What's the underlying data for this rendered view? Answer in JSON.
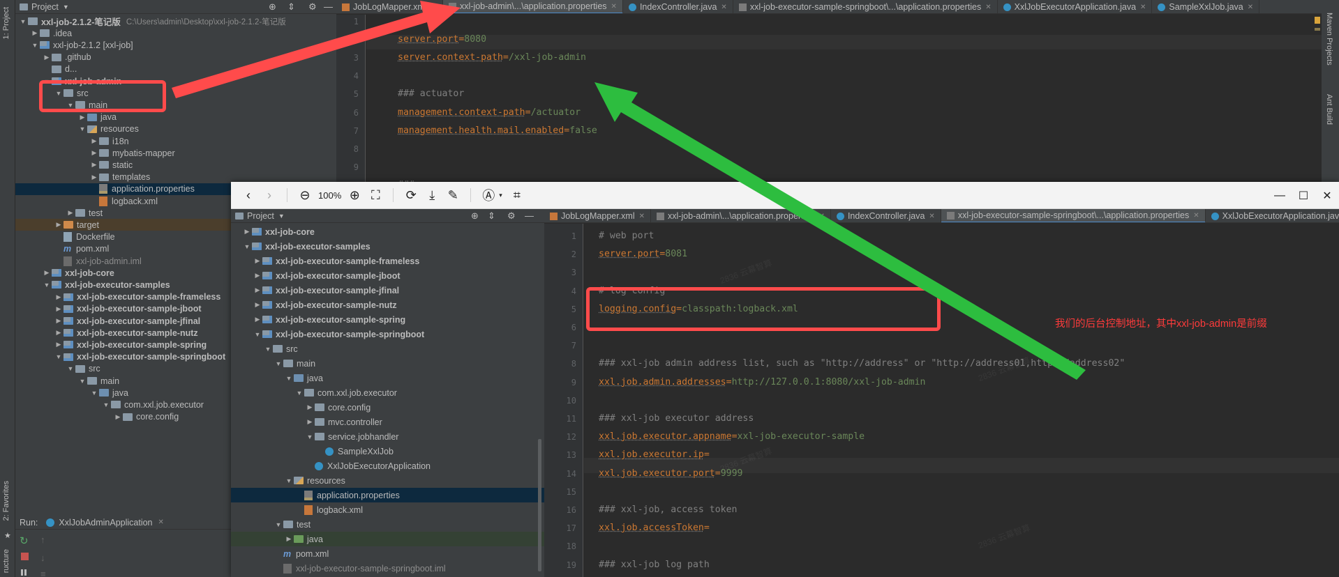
{
  "left_strip": {
    "project_label": "1: Project",
    "favorites_label": "2: Favorites",
    "structure_label": "ructure"
  },
  "right_strip": {
    "maven_label": "Maven Projects",
    "ant_label": "Ant Build"
  },
  "bg_project": {
    "header": "Project",
    "root_name": "xxl-job-2.1.2-笔记版",
    "root_path": "C:\\Users\\admin\\Desktop\\xxl-job-2.1.2-笔记版",
    "items": [
      {
        "label": "root",
        "depth": 0,
        "icon": "folder"
      },
      {
        "label": ".idea",
        "depth": 1,
        "icon": "folder"
      },
      {
        "label": "xxl-job-2.1.2 [xxl-job]",
        "depth": 1,
        "icon": "module"
      },
      {
        "label": ".github",
        "depth": 2,
        "icon": "folder"
      },
      {
        "label": "d...",
        "depth": 2,
        "icon": "folder"
      },
      {
        "label": "xxl-job-admin",
        "depth": 2,
        "icon": "module"
      },
      {
        "label": "src",
        "depth": 3,
        "icon": "folder"
      },
      {
        "label": "main",
        "depth": 4,
        "icon": "folder"
      },
      {
        "label": "java",
        "depth": 5,
        "icon": "src"
      },
      {
        "label": "resources",
        "depth": 5,
        "icon": "res"
      },
      {
        "label": "i18n",
        "depth": 6,
        "icon": "folder"
      },
      {
        "label": "mybatis-mapper",
        "depth": 6,
        "icon": "folder"
      },
      {
        "label": "static",
        "depth": 6,
        "icon": "folder"
      },
      {
        "label": "templates",
        "depth": 6,
        "icon": "folder"
      },
      {
        "label": "application.properties",
        "depth": 6,
        "icon": "prop"
      },
      {
        "label": "logback.xml",
        "depth": 6,
        "icon": "xml"
      },
      {
        "label": "test",
        "depth": 4,
        "icon": "folder"
      },
      {
        "label": "target",
        "depth": 3,
        "icon": "orange"
      },
      {
        "label": "Dockerfile",
        "depth": 3,
        "icon": "doc"
      },
      {
        "label": "pom.xml",
        "depth": 3,
        "icon": "m"
      },
      {
        "label": "xxl-job-admin.iml",
        "depth": 3,
        "icon": "iml"
      },
      {
        "label": "xxl-job-core",
        "depth": 2,
        "icon": "module"
      },
      {
        "label": "xxl-job-executor-samples",
        "depth": 2,
        "icon": "module"
      },
      {
        "label": "xxl-job-executor-sample-frameless",
        "depth": 3,
        "icon": "module"
      },
      {
        "label": "xxl-job-executor-sample-jboot",
        "depth": 3,
        "icon": "module"
      },
      {
        "label": "xxl-job-executor-sample-jfinal",
        "depth": 3,
        "icon": "module"
      },
      {
        "label": "xxl-job-executor-sample-nutz",
        "depth": 3,
        "icon": "module"
      },
      {
        "label": "xxl-job-executor-sample-spring",
        "depth": 3,
        "icon": "module"
      },
      {
        "label": "xxl-job-executor-sample-springboot",
        "depth": 3,
        "icon": "module"
      },
      {
        "label": "src",
        "depth": 4,
        "icon": "folder"
      },
      {
        "label": "main",
        "depth": 5,
        "icon": "folder"
      },
      {
        "label": "java",
        "depth": 6,
        "icon": "src"
      },
      {
        "label": "com.xxl.job.executor",
        "depth": 7,
        "icon": "folder"
      },
      {
        "label": "core.config",
        "depth": 8,
        "icon": "folder"
      }
    ]
  },
  "bg_tabs": [
    {
      "label": "JobLogMapper.xml",
      "icon": "xml"
    },
    {
      "label": "xxl-job-admin\\...\\application.properties",
      "icon": "prop",
      "active": true
    },
    {
      "label": "IndexController.java",
      "icon": "cls"
    },
    {
      "label": "xxl-job-executor-sample-springboot\\...\\application.properties",
      "icon": "prop"
    },
    {
      "label": "XxlJobExecutorApplication.java",
      "icon": "cls"
    },
    {
      "label": "SampleXxlJob.java",
      "icon": "cls"
    }
  ],
  "bg_code": [
    {
      "n": "1",
      "text": ""
    },
    {
      "n": "2",
      "key": "server.port",
      "val": "8080"
    },
    {
      "n": "3",
      "key": "server.context-path",
      "val": "/xxl-job-admin"
    },
    {
      "n": "4",
      "text": ""
    },
    {
      "n": "5",
      "comment": "### actuator"
    },
    {
      "n": "6",
      "key": "management.context-path",
      "val": "/actuator"
    },
    {
      "n": "7",
      "key": "management.health.mail.enabled",
      "val": "false"
    },
    {
      "n": "8",
      "text": ""
    },
    {
      "n": "9",
      "text": ""
    },
    {
      "n": "10",
      "comment": "### resources"
    }
  ],
  "run_bar": {
    "label": "Run:",
    "config": "XxlJobAdminApplication"
  },
  "viewer": {
    "zoom": "100%",
    "project_header": "Project",
    "tree": [
      {
        "label": "xxl-job-core",
        "depth": 0,
        "icon": "module",
        "bold": true,
        "arrow": "right"
      },
      {
        "label": "xxl-job-executor-samples",
        "depth": 0,
        "icon": "module",
        "bold": true,
        "arrow": "down"
      },
      {
        "label": "xxl-job-executor-sample-frameless",
        "depth": 1,
        "icon": "module",
        "bold": true,
        "arrow": "right"
      },
      {
        "label": "xxl-job-executor-sample-jboot",
        "depth": 1,
        "icon": "module",
        "bold": true,
        "arrow": "right"
      },
      {
        "label": "xxl-job-executor-sample-jfinal",
        "depth": 1,
        "icon": "module",
        "bold": true,
        "arrow": "right"
      },
      {
        "label": "xxl-job-executor-sample-nutz",
        "depth": 1,
        "icon": "module",
        "bold": true,
        "arrow": "right"
      },
      {
        "label": "xxl-job-executor-sample-spring",
        "depth": 1,
        "icon": "module",
        "bold": true,
        "arrow": "right"
      },
      {
        "label": "xxl-job-executor-sample-springboot",
        "depth": 1,
        "icon": "module",
        "bold": true,
        "arrow": "down"
      },
      {
        "label": "src",
        "depth": 2,
        "icon": "folder",
        "arrow": "down"
      },
      {
        "label": "main",
        "depth": 3,
        "icon": "folder",
        "arrow": "down"
      },
      {
        "label": "java",
        "depth": 4,
        "icon": "src",
        "arrow": "down"
      },
      {
        "label": "com.xxl.job.executor",
        "depth": 5,
        "icon": "folder",
        "arrow": "down"
      },
      {
        "label": "core.config",
        "depth": 6,
        "icon": "folder",
        "arrow": "right"
      },
      {
        "label": "mvc.controller",
        "depth": 6,
        "icon": "folder",
        "arrow": "right"
      },
      {
        "label": "service.jobhandler",
        "depth": 6,
        "icon": "folder",
        "arrow": "down"
      },
      {
        "label": "SampleXxlJob",
        "depth": 7,
        "icon": "cls"
      },
      {
        "label": "XxlJobExecutorApplication",
        "depth": 6,
        "icon": "cls"
      },
      {
        "label": "resources",
        "depth": 4,
        "icon": "res",
        "arrow": "down"
      },
      {
        "label": "application.properties",
        "depth": 5,
        "icon": "prop",
        "selected": true
      },
      {
        "label": "logback.xml",
        "depth": 5,
        "icon": "xml"
      },
      {
        "label": "test",
        "depth": 3,
        "icon": "folder",
        "arrow": "down"
      },
      {
        "label": "java",
        "depth": 4,
        "icon": "tst",
        "arrow": "right",
        "test": true
      },
      {
        "label": "pom.xml",
        "depth": 3,
        "icon": "m"
      },
      {
        "label": "xxl-job-executor-sample-springboot.iml",
        "depth": 3,
        "icon": "iml"
      }
    ],
    "tabs": [
      {
        "label": "JobLogMapper.xml",
        "icon": "xml"
      },
      {
        "label": "xxl-job-admin\\...\\application.properties",
        "icon": "prop"
      },
      {
        "label": "IndexController.java",
        "icon": "cls"
      },
      {
        "label": "xxl-job-executor-sample-springboot\\...\\application.properties",
        "icon": "prop",
        "active": true
      },
      {
        "label": "XxlJobExecutorApplication.java",
        "icon": "cls"
      }
    ],
    "code": [
      {
        "n": "1",
        "comment": "# web port"
      },
      {
        "n": "2",
        "key": "server.port",
        "val": "8081"
      },
      {
        "n": "3",
        "text": ""
      },
      {
        "n": "4",
        "comment": "# log config"
      },
      {
        "n": "5",
        "key": "logging.config",
        "val": "classpath:logback.xml"
      },
      {
        "n": "6",
        "text": ""
      },
      {
        "n": "7",
        "text": ""
      },
      {
        "n": "8",
        "comment": "### xxl-job admin address list, such as \"http://address\" or \"http://address01,http://address02\""
      },
      {
        "n": "9",
        "key": "xxl.job.admin.addresses",
        "val": "http://127.0.0.1:8080/xxl-job-admin"
      },
      {
        "n": "10",
        "text": ""
      },
      {
        "n": "11",
        "comment": "### xxl-job executor address"
      },
      {
        "n": "12",
        "key": "xxl.job.executor.appname",
        "val": "xxl-job-executor-sample"
      },
      {
        "n": "13",
        "key": "xxl.job.executor.ip",
        "val": ""
      },
      {
        "n": "14",
        "key": "xxl.job.executor.port",
        "val": "9999"
      },
      {
        "n": "15",
        "text": ""
      },
      {
        "n": "16",
        "comment": "### xxl-job, access token"
      },
      {
        "n": "17",
        "key": "xxl.job.accessToken",
        "val": ""
      },
      {
        "n": "18",
        "text": ""
      },
      {
        "n": "19",
        "comment": "### xxl-job log path"
      }
    ]
  },
  "annotation": {
    "note": "我们的后台控制地址，其中xxl-job-admin是前缀",
    "red": "#ff4b4b",
    "green": "#2dbd3f"
  },
  "watermark": "2836 云幕智算",
  "colors": {
    "bg": "#2b2b2b",
    "panel": "#3c3f41",
    "key": "#cc7832",
    "value": "#6a8759",
    "comment": "#808080",
    "selected": "#0d293e"
  }
}
